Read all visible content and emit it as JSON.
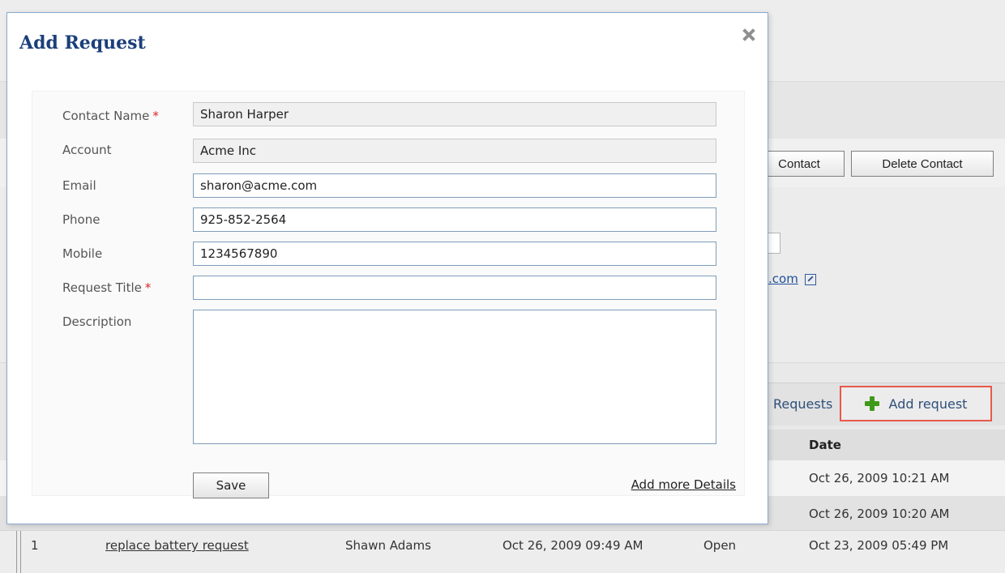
{
  "modal": {
    "title": "Add Request",
    "fields": {
      "contact_name": {
        "label": "Contact Name",
        "value": "Sharon Harper",
        "required": "*"
      },
      "account": {
        "label": "Account",
        "value": "Acme Inc"
      },
      "email": {
        "label": "Email",
        "value": "sharon@acme.com"
      },
      "phone": {
        "label": "Phone",
        "value": "925-852-2564"
      },
      "mobile": {
        "label": "Mobile",
        "value": "1234567890"
      },
      "request_title": {
        "label": "Request Title",
        "value": "",
        "required": "*"
      },
      "description": {
        "label": "Description",
        "value": ""
      }
    },
    "save_label": "Save",
    "more_details_label": "Add more Details"
  },
  "background": {
    "edit_contact_label": "Contact",
    "delete_contact_label": "Delete Contact",
    "email_link_fragment": ".com",
    "requests_tab_label": "Requests",
    "add_request_label": "Add request",
    "date_header": "Date",
    "rows": [
      {
        "num": "",
        "title": "",
        "contact": "",
        "created": "",
        "status": "",
        "date": "Oct 26, 2009 10:21 AM"
      },
      {
        "num": "",
        "title": "",
        "contact": "",
        "created": "",
        "status": "",
        "date": "Oct 26, 2009 10:20 AM"
      },
      {
        "num": "1",
        "title": "replace battery request",
        "contact": "Shawn Adams",
        "created": "Oct 26, 2009 09:49 AM",
        "status": "Open",
        "date": "Oct 23, 2009 05:49 PM"
      }
    ]
  },
  "colors": {
    "modal_title": "#1b3f7a",
    "highlight_border": "#e8594a",
    "plus_icon": "#3f9a1a",
    "required_star": "#d9242a"
  }
}
